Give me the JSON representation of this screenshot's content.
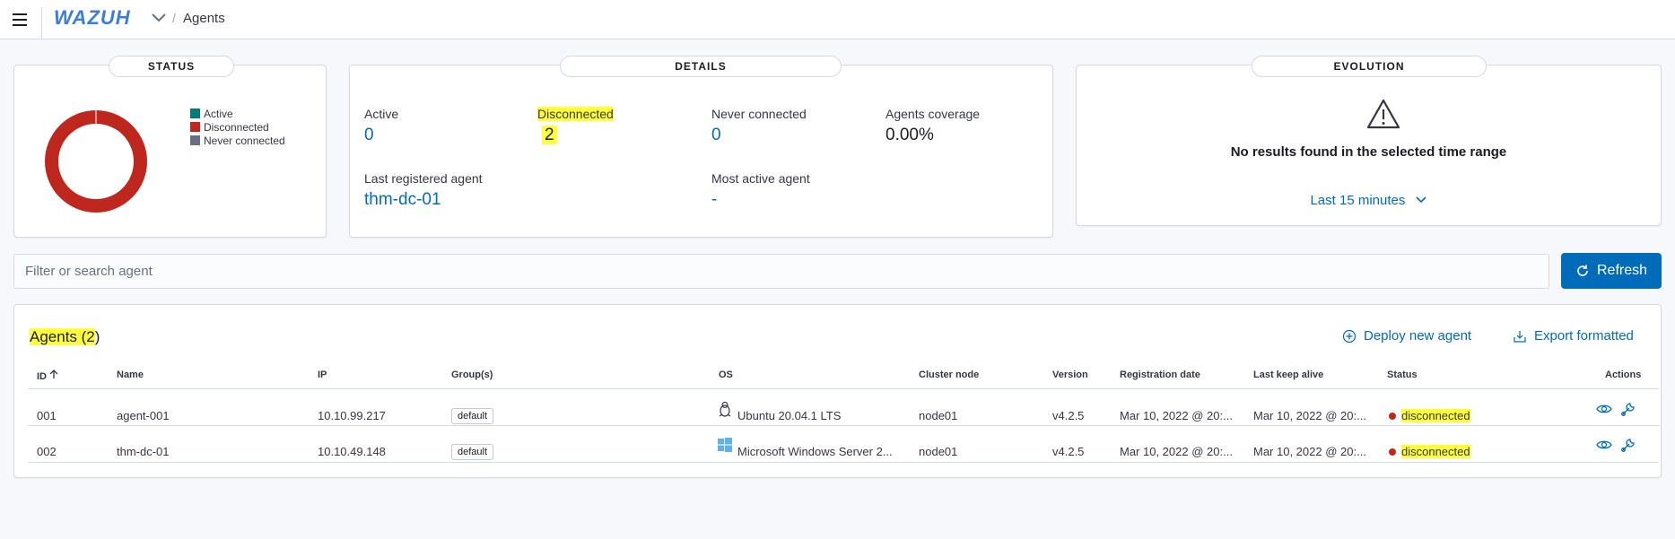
{
  "header": {
    "logo": "WAZUH",
    "separator": "/",
    "breadcrumb": "Agents"
  },
  "status_panel": {
    "title": "STATUS",
    "legend": [
      {
        "label": "Active",
        "color": "#017d73"
      },
      {
        "label": "Disconnected",
        "color": "#bd271e"
      },
      {
        "label": "Never connected",
        "color": "#69707d"
      }
    ],
    "donut_values": {
      "active": 0,
      "disconnected": 2,
      "never_connected": 0
    }
  },
  "details_panel": {
    "title": "DETAILS",
    "active_label": "Active",
    "active_value": "0",
    "disconnected_label": "Disconnected",
    "disconnected_value": "2",
    "never_label": "Never connected",
    "never_value": "0",
    "coverage_label": "Agents coverage",
    "coverage_value": "0.00%",
    "last_registered_label": "Last registered agent",
    "last_registered_value": "thm-dc-01",
    "most_active_label": "Most active agent",
    "most_active_value": "-"
  },
  "evolution_panel": {
    "title": "EVOLUTION",
    "message": "No results found in the selected time range",
    "time_range": "Last 15 minutes"
  },
  "search": {
    "placeholder": "Filter or search agent"
  },
  "refresh_label": "Refresh",
  "table": {
    "title_prefix": "Agents (2",
    "title_suffix": ")",
    "deploy_label": "Deploy new agent",
    "export_label": "Export formatted",
    "columns": [
      "ID",
      "Name",
      "IP",
      "Group(s)",
      "OS",
      "Cluster node",
      "Version",
      "Registration date",
      "Last keep alive",
      "Status",
      "Actions"
    ],
    "rows": [
      {
        "id": "001",
        "name": "agent-001",
        "ip": "10.10.99.217",
        "group": "default",
        "os": "Ubuntu 20.04.1 LTS",
        "os_icon": "linux-icon",
        "node": "node01",
        "version": "v4.2.5",
        "reg": "Mar 10, 2022 @ 20:...",
        "keep": "Mar 10, 2022 @ 20:...",
        "status": "disconnected"
      },
      {
        "id": "002",
        "name": "thm-dc-01",
        "ip": "10.10.49.148",
        "group": "default",
        "os": "Microsoft Windows Server 2...",
        "os_icon": "windows-icon",
        "node": "node01",
        "version": "v4.2.5",
        "reg": "Mar 10, 2022 @ 20:...",
        "keep": "Mar 10, 2022 @ 20:...",
        "status": "disconnected"
      }
    ]
  },
  "colors": {
    "accent": "#006bb8",
    "highlight": "#ffff3a",
    "disconnected": "#bd271e"
  }
}
